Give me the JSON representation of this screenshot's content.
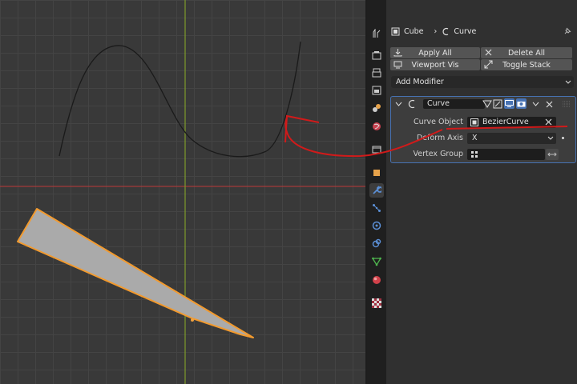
{
  "breadcrumb": {
    "object": "Cube",
    "modifier": "Curve"
  },
  "toolbar": {
    "apply_all": "Apply All",
    "delete_all": "Delete All",
    "viewport_vis": "Viewport Vis",
    "toggle_stack": "Toggle Stack"
  },
  "add_modifier": "Add Modifier",
  "modifier": {
    "name": "Curve",
    "curve_object_label": "Curve Object",
    "curve_object_value": "BezierCurve",
    "deform_axis_label": "Deform Axis",
    "deform_axis_value": "X",
    "vertex_group_label": "Vertex Group",
    "vertex_group_value": ""
  },
  "sidebar_tabs": [
    "tool-icon",
    "render-icon",
    "output-icon",
    "view-layer-icon",
    "scene-icon",
    "world-icon",
    "collection-icon",
    "object-icon",
    "modifier-wrench-icon",
    "particles-icon",
    "physics-icon",
    "constraints-icon",
    "data-icon",
    "material-icon",
    "texture-icon"
  ],
  "colors": {
    "accent_blue": "#4772b3",
    "selection_orange": "#f28c22",
    "annotation_red": "#d11a1a",
    "x_axis_red": "#a33a3a",
    "y_axis_green": "#7d9a2a"
  }
}
